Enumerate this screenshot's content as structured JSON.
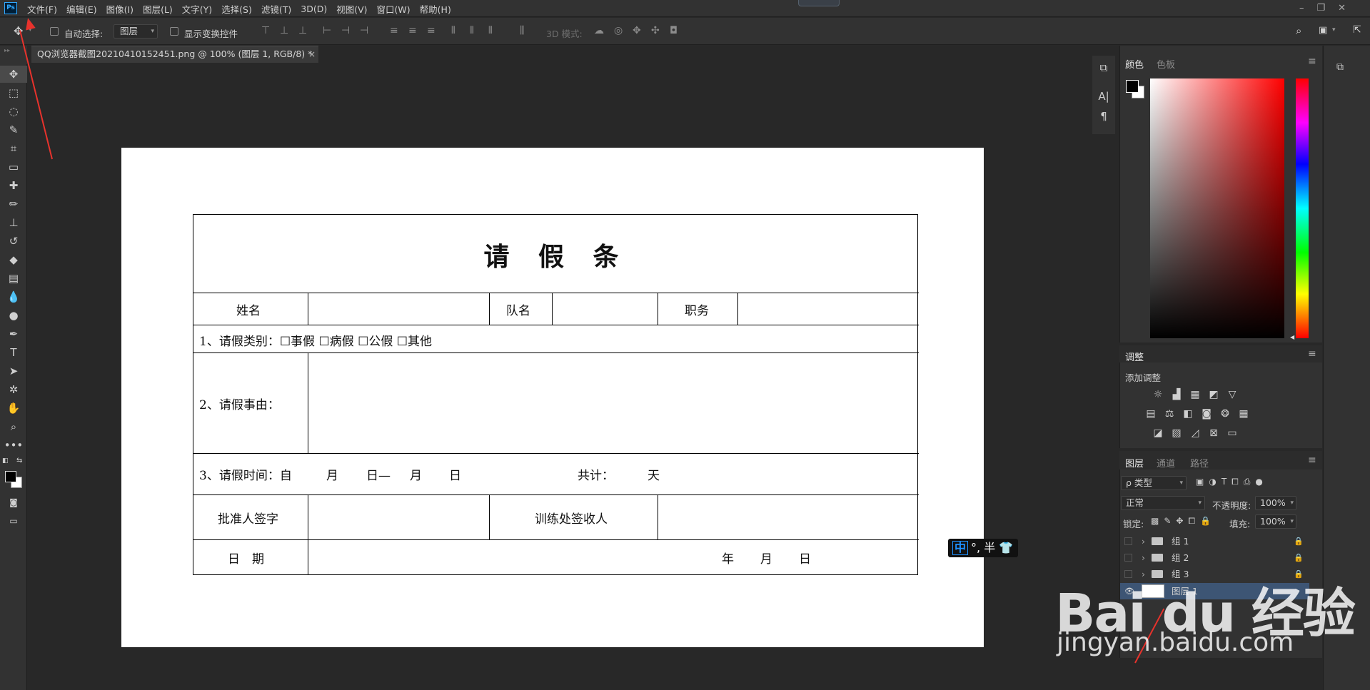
{
  "menubar": {
    "logo": "Ps",
    "items": [
      "文件(F)",
      "编辑(E)",
      "图像(I)",
      "图层(L)",
      "文字(Y)",
      "选择(S)",
      "滤镜(T)",
      "3D(D)",
      "视图(V)",
      "窗口(W)",
      "帮助(H)"
    ],
    "win_minimize": "–",
    "win_restore": "❐",
    "win_close": "✕"
  },
  "options": {
    "auto_select_label": "自动选择:",
    "auto_select_value": "图层",
    "show_transform_label": "显示变换控件",
    "mode_3d_label": "3D 模式:"
  },
  "document_tab": {
    "title": "QQ浏览器截图20210410152451.png @ 100% (图层 1, RGB/8) *",
    "close": "×"
  },
  "form": {
    "title": "请 假 条",
    "name_label": "姓名",
    "team_label": "队名",
    "position_label": "职务",
    "category_line": "1、请假类别：☐事假 ☐病假 ☐公假 ☐其他",
    "reason_label": "2、请假事由：",
    "time_prefix": "3、请假时间：自",
    "time_month1": "月",
    "time_day1": "日—",
    "time_month2": "月",
    "time_day2": "日",
    "total_label": "共计：",
    "days_unit": "天",
    "approver_label": "批准人签字",
    "office_label": "训练处签收人",
    "date_label": "日　期",
    "date_year": "年",
    "date_month": "月",
    "date_day": "日"
  },
  "ime": {
    "mode": "中",
    "rest": "°, 半 👕"
  },
  "color_panel": {
    "tab_active": "颜色",
    "tab_inactive": "色板",
    "menu": "≡",
    "foreground": "#000000",
    "background": "#ffffff"
  },
  "adjust_panel": {
    "tab": "调整",
    "menu": "≡",
    "add_label": "添加调整"
  },
  "layers_panel": {
    "tabs": [
      "图层",
      "通道",
      "路径"
    ],
    "menu": "≡",
    "filter_value": "ρ 类型",
    "blend_mode": "正常",
    "opacity_label": "不透明度:",
    "opacity_value": "100%",
    "lock_label": "锁定:",
    "fill_label": "填充:",
    "fill_value": "100%",
    "layers": [
      {
        "name": "组 1",
        "type": "group"
      },
      {
        "name": "组 2",
        "type": "group"
      },
      {
        "name": "组 3",
        "type": "group"
      },
      {
        "name": "图层 1",
        "type": "layer",
        "selected": true
      }
    ]
  },
  "watermark": {
    "logo": "Bai du 经验",
    "url": "jingyan.baidu.com"
  }
}
